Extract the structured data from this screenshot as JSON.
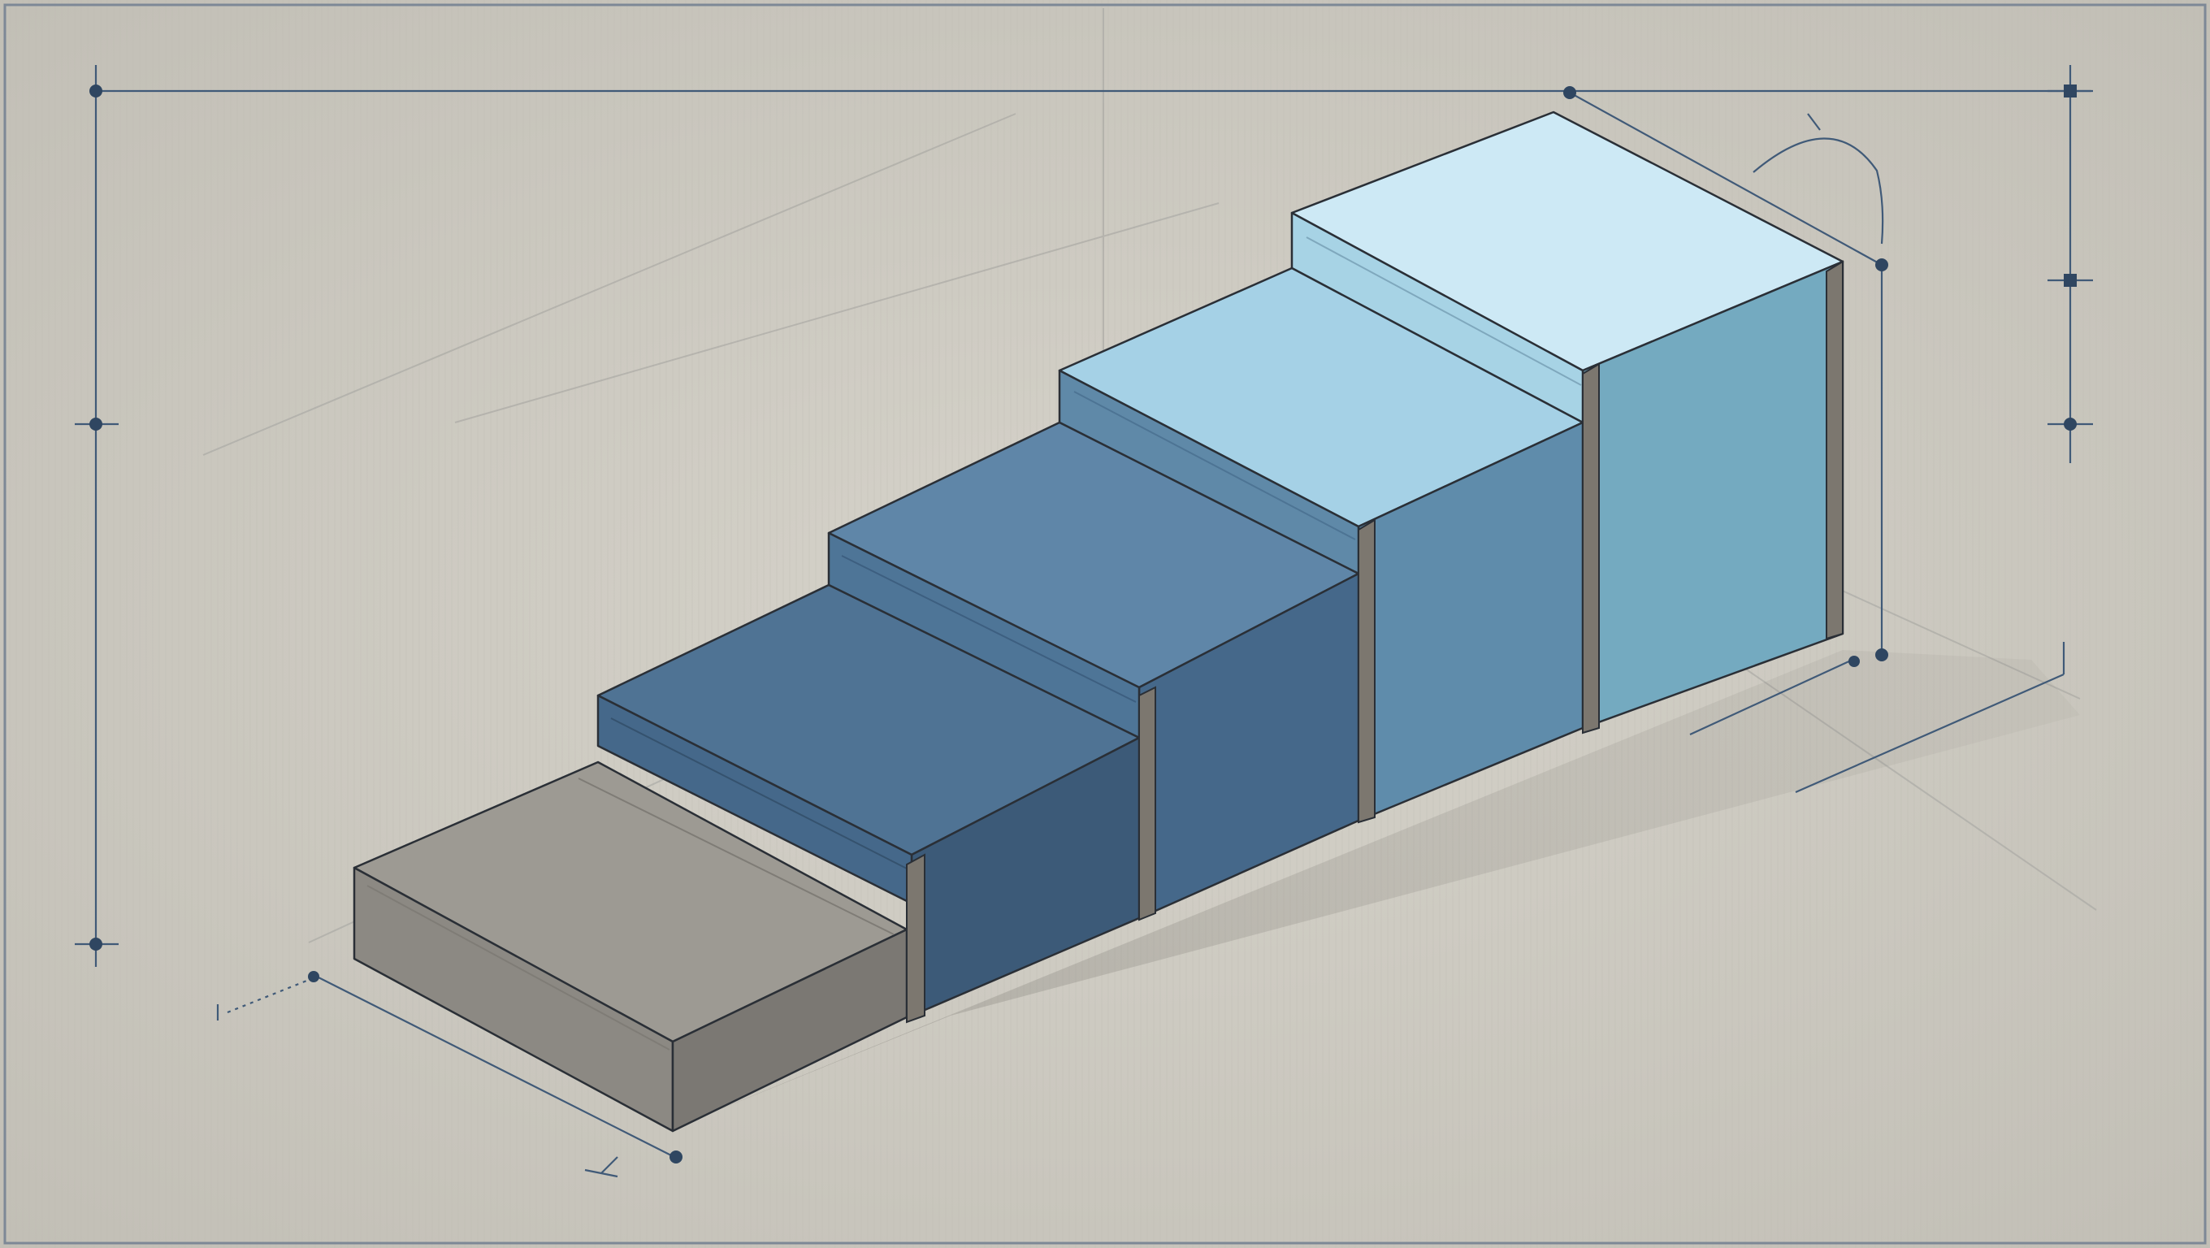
{
  "palette": {
    "background": "#c9c6bd",
    "background_light": "#d4d1c8",
    "frame": "#6f7b8a",
    "guide": "#8d8f93",
    "annotation": "#2f4661",
    "outline": "#2a2f36",
    "separator": "#7c776f",
    "step_gray": {
      "top": "#9d9a93",
      "front": "#8c8983",
      "side": "#7b7873"
    },
    "step_dark_blue": {
      "top": "#4f7394",
      "front": "#45688a",
      "side": "#3c5a78"
    },
    "step_mid_blue": {
      "top": "#5f86a8",
      "front": "#4e7597",
      "side": "#44698b"
    },
    "step_light_blue": {
      "top": "#a5d1e6",
      "front": "#5f8cab",
      "side": "#4f7897"
    },
    "step_pale_blue": {
      "top": "#cde9f5",
      "front": "#74aac0",
      "side": "#6b9fb5"
    }
  },
  "diagram": {
    "subject": "isometric-staircase",
    "step_count": 5,
    "steps": [
      {
        "id": "step-1",
        "color_key": "step_gray"
      },
      {
        "id": "step-2",
        "color_key": "step_dark_blue"
      },
      {
        "id": "step-3",
        "color_key": "step_mid_blue"
      },
      {
        "id": "step-4",
        "color_key": "step_light_blue"
      },
      {
        "id": "step-5",
        "color_key": "step_pale_blue"
      }
    ],
    "annotations": [
      "top-dimension-line",
      "left-vertical-dimension-line",
      "right-vertical-dimension-line",
      "rise-dimension-line",
      "angle-arc",
      "base-width-dimension-line",
      "shadow-dimension-lines"
    ]
  }
}
